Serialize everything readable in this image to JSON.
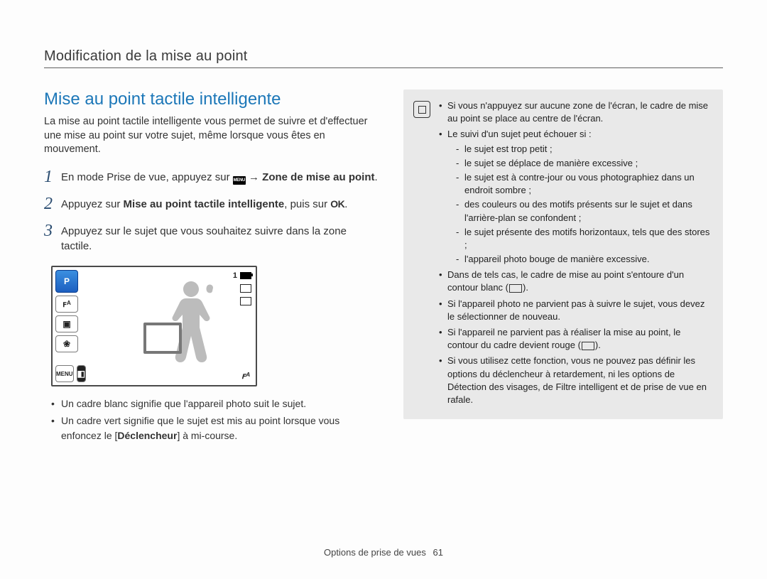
{
  "chapter": "Modification de la mise au point",
  "section_title": "Mise au point tactile intelligente",
  "intro": "La mise au point tactile intelligente vous permet de suivre et d'effectuer une mise au point sur votre sujet, même lorsque vous êtes en mouvement.",
  "steps": [
    {
      "num": "1",
      "pre": "En mode Prise de vue, appuyez sur ",
      "menu_icon_label": "MENU",
      "arrow": " → ",
      "bold": "Zone de mise au point",
      "post": "."
    },
    {
      "num": "2",
      "pre": "Appuyez sur ",
      "bold": "Mise au point tactile intelligente",
      "mid": ", puis sur ",
      "ok_label": "OK",
      "post": "."
    },
    {
      "num": "3",
      "text": "Appuyez sur le sujet que vous souhaitez suivre dans la zone tactile."
    }
  ],
  "lcd": {
    "p_label": "P",
    "flash_auto": "ꜰᴬ",
    "af_mode": "▣",
    "macro": "❀",
    "menu_label": "MENU",
    "gallery": "◧",
    "counter": "1",
    "corner_flash": "ꜰᴬ"
  },
  "hints": [
    "Un cadre blanc signifie que l'appareil photo suit le sujet.",
    {
      "pre": "Un cadre vert signifie que le sujet est mis au point lorsque vous enfoncez le [",
      "bold": "Déclencheur",
      "post": "] à mi-course."
    }
  ],
  "note": {
    "bullets": [
      "Si vous n'appuyez sur aucune zone de l'écran, le cadre de mise au point se place au centre de l'écran.",
      {
        "lead": "Le suivi d'un sujet peut échouer si :",
        "sub": [
          "le sujet est trop petit ;",
          "le sujet se déplace de manière excessive ;",
          "le sujet est à contre-jour ou vous photographiez dans un endroit sombre ;",
          "des couleurs ou des motifs présents sur le sujet et dans l'arrière-plan se confondent ;",
          "le sujet présente des motifs horizontaux, tels que des stores ;",
          "l'appareil photo bouge de manière excessive."
        ]
      },
      {
        "pre": "Dans de tels cas, le cadre de mise au point s'entoure d'un contour blanc (",
        "rect": true,
        "post": ")."
      },
      "Si l'appareil photo ne parvient pas à suivre le sujet, vous devez le sélectionner de nouveau.",
      {
        "pre": "Si l'appareil ne parvient pas à réaliser la mise au point, le contour du cadre devient rouge (",
        "rect": true,
        "post": ")."
      },
      "Si vous utilisez cette fonction, vous ne pouvez pas définir les options du déclencheur à retardement, ni les options de Détection des visages, de Filtre intelligent et de prise de vue en rafale."
    ]
  },
  "footer": {
    "section": "Options de prise de vues",
    "page": "61"
  }
}
